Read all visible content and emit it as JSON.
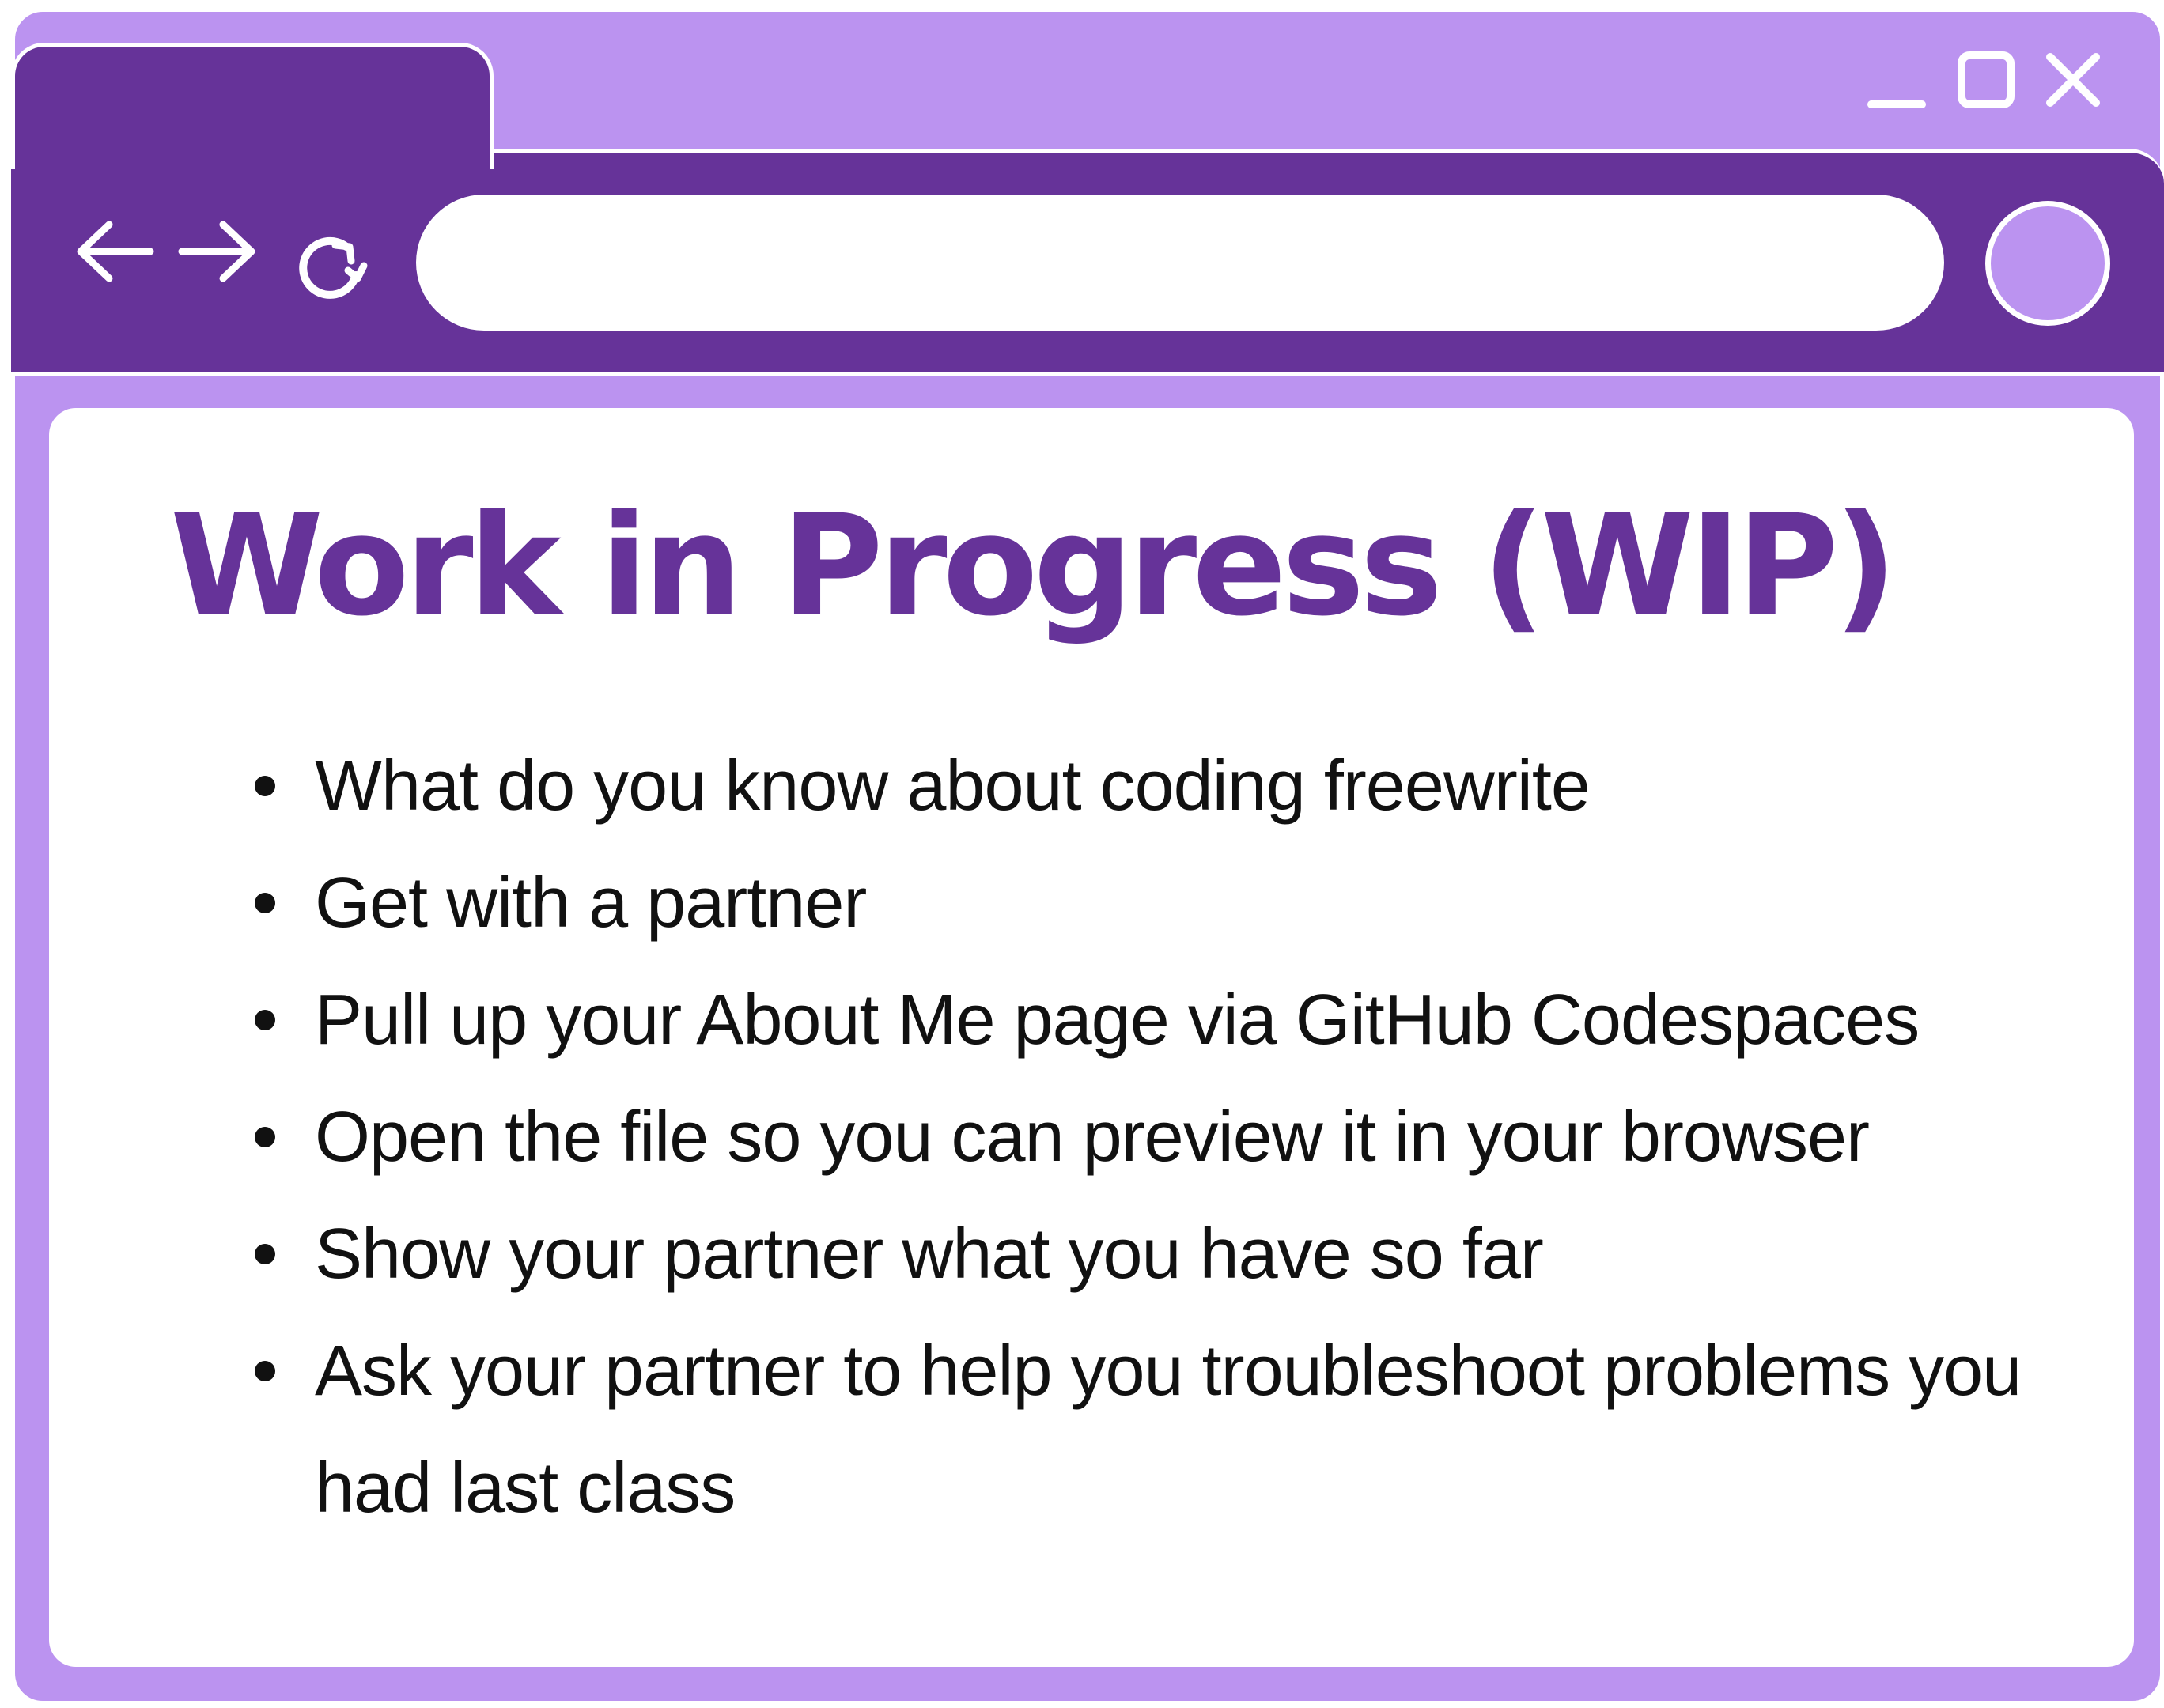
{
  "window": {
    "controls": {
      "minimize_icon": "minimize-icon",
      "maximize_icon": "maximize-icon",
      "close_icon": "close-icon"
    },
    "colors": {
      "frame": "#bb93f0",
      "toolbar": "#663399",
      "page": "#ffffff",
      "title_text": "#663399",
      "body_text": "#111111"
    }
  },
  "toolbar": {
    "back_icon": "arrow-left-icon",
    "forward_icon": "arrow-right-icon",
    "reload_icon": "reload-icon",
    "address_value": "",
    "profile_icon": "profile-circle-icon"
  },
  "page": {
    "title": "Work in Progress (WIP)",
    "items": [
      "What do you know about coding freewrite",
      "Get with a partner",
      "Pull up your About Me page via GitHub Codespaces",
      "Open the file so you can preview it in your browser",
      "Show your partner what you have so far",
      "Ask your partner to help you troubleshoot problems you had last class"
    ]
  }
}
